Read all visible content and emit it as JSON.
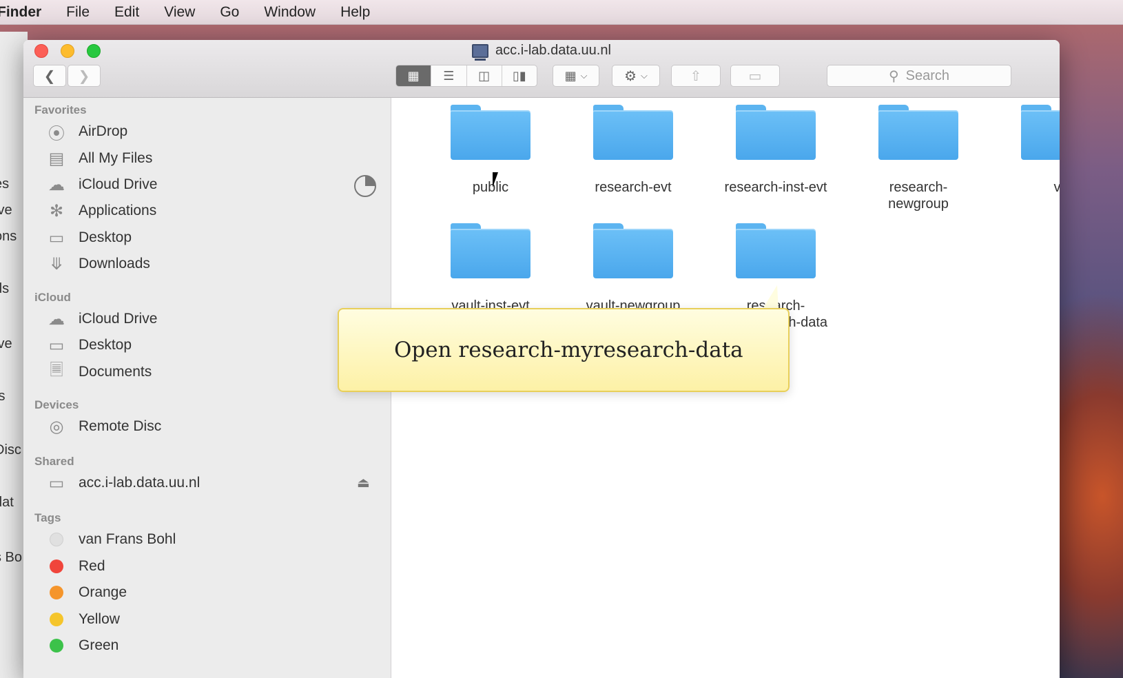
{
  "menubar": {
    "items": [
      "Finder",
      "File",
      "Edit",
      "View",
      "Go",
      "Window",
      "Help"
    ]
  },
  "background_window": {
    "fragments": [
      "es",
      "ive",
      "ons",
      "ds",
      "ive",
      "ts",
      "Disc",
      "dat",
      "s Bo"
    ]
  },
  "window": {
    "title": "acc.i-lab.data.uu.nl",
    "search_placeholder": "Search"
  },
  "sidebar": {
    "favorites_header": "Favorites",
    "favorites": [
      {
        "label": "AirDrop",
        "icon": "airdrop-icon"
      },
      {
        "label": "All My Files",
        "icon": "all-files-icon"
      },
      {
        "label": "iCloud Drive",
        "icon": "cloud-icon"
      },
      {
        "label": "Applications",
        "icon": "applications-icon"
      },
      {
        "label": "Desktop",
        "icon": "desktop-icon"
      },
      {
        "label": "Downloads",
        "icon": "downloads-icon"
      }
    ],
    "icloud_header": "iCloud",
    "icloud": [
      {
        "label": "iCloud Drive",
        "icon": "cloud-icon"
      },
      {
        "label": "Desktop",
        "icon": "desktop-icon"
      },
      {
        "label": "Documents",
        "icon": "documents-icon"
      }
    ],
    "devices_header": "Devices",
    "devices": [
      {
        "label": "Remote Disc",
        "icon": "disc-icon"
      }
    ],
    "shared_header": "Shared",
    "shared": [
      {
        "label": "acc.i-lab.data.uu.nl",
        "icon": "server-icon"
      }
    ],
    "tags_header": "Tags",
    "tags": [
      {
        "label": "van Frans Bohl",
        "color": "#e0e0e0"
      },
      {
        "label": "Red",
        "color": "#f0453b"
      },
      {
        "label": "Orange",
        "color": "#f5952b"
      },
      {
        "label": "Yellow",
        "color": "#f5c52b"
      },
      {
        "label": "Green",
        "color": "#3cc24a"
      }
    ]
  },
  "content": {
    "folders": [
      {
        "label": "public"
      },
      {
        "label": "research-evt"
      },
      {
        "label": "research-inst-evt"
      },
      {
        "label": "research-\nnewgroup"
      },
      {
        "label": "va"
      },
      {
        "label": "vault-inst-evt"
      },
      {
        "label": "vault-newgroup"
      },
      {
        "label": "research-\nmyresearch-data"
      }
    ]
  },
  "callout": {
    "text": "Open research-myresearch-data"
  },
  "colors": {
    "folder": "#5cb4f0",
    "callout_bg": "#fdf1a6",
    "callout_border": "#e8cf5a"
  }
}
